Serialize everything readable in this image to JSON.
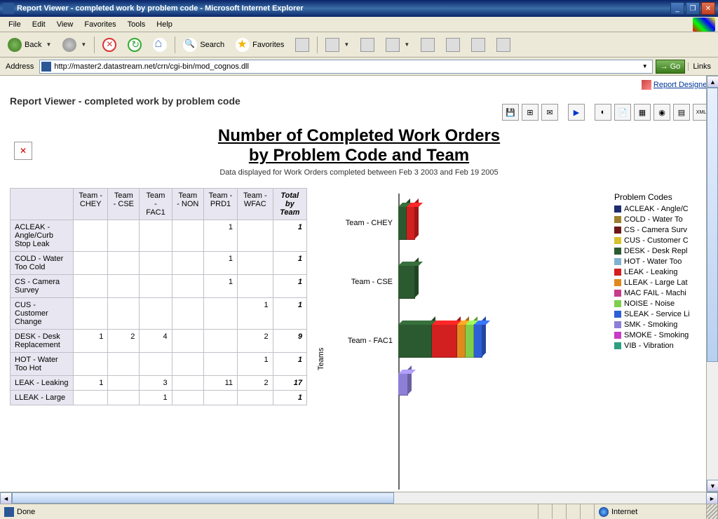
{
  "window": {
    "title": "Report Viewer - completed work by problem code - Microsoft Internet Explorer",
    "min": "_",
    "restore": "❐",
    "close": "✕"
  },
  "menu": {
    "file": "File",
    "edit": "Edit",
    "view": "View",
    "favorites": "Favorites",
    "tools": "Tools",
    "help": "Help"
  },
  "toolbar": {
    "back": "Back",
    "search": "Search",
    "favorites": "Favorites"
  },
  "address": {
    "label": "Address",
    "url": "http://master2.datastream.net/crn/cgi-bin/mod_cognos.dll",
    "go": "Go",
    "links": "Links"
  },
  "content": {
    "designer": "Report Designer",
    "page_title": "Report Viewer - completed work by problem code",
    "chart_title_l1": "Number of Completed Work Orders",
    "chart_title_l2": "by Problem Code and Team",
    "subtitle": "Data displayed for Work Orders completed between Feb 3 2003 and Feb 19 2005",
    "columns": [
      "Team - CHEY",
      "Team - CSE",
      "Team - FAC1",
      "Team - NON",
      "Team - PRD1",
      "Team - WFAC"
    ],
    "total_col": "Total by Team",
    "rows": [
      {
        "label": "ACLEAK - Angle/Curb Stop Leak",
        "cells": [
          "",
          "",
          "",
          "",
          "1",
          ""
        ],
        "total": "1"
      },
      {
        "label": "COLD - Water Too Cold",
        "cells": [
          "",
          "",
          "",
          "",
          "1",
          ""
        ],
        "total": "1"
      },
      {
        "label": "CS - Camera Survey",
        "cells": [
          "",
          "",
          "",
          "",
          "1",
          ""
        ],
        "total": "1"
      },
      {
        "label": "CUS - Customer Change",
        "cells": [
          "",
          "",
          "",
          "",
          "",
          "1"
        ],
        "total": "1"
      },
      {
        "label": "DESK - Desk Replacement",
        "cells": [
          "1",
          "2",
          "4",
          "",
          "",
          "2"
        ],
        "total": "9"
      },
      {
        "label": "HOT - Water Too Hot",
        "cells": [
          "",
          "",
          "",
          "",
          "",
          "1"
        ],
        "total": "1"
      },
      {
        "label": "LEAK - Leaking",
        "cells": [
          "1",
          "",
          "3",
          "",
          "11",
          "2"
        ],
        "total": "17"
      },
      {
        "label": "LLEAK - Large",
        "cells": [
          "",
          "",
          "1",
          "",
          "",
          ""
        ],
        "total": "1"
      }
    ],
    "legend_title": "Problem Codes",
    "legend": [
      {
        "c": "c-acleak",
        "t": "ACLEAK - Angle/C"
      },
      {
        "c": "c-cold",
        "t": "COLD - Water To"
      },
      {
        "c": "c-cs",
        "t": "CS - Camera Surv"
      },
      {
        "c": "c-cus",
        "t": "CUS - Customer C"
      },
      {
        "c": "c-desk",
        "t": "DESK - Desk Repl"
      },
      {
        "c": "c-hot",
        "t": "HOT - Water Too"
      },
      {
        "c": "c-leak",
        "t": "LEAK - Leaking"
      },
      {
        "c": "c-lleak",
        "t": "LLEAK - Large Lat"
      },
      {
        "c": "c-mac",
        "t": "MAC FAIL - Machi"
      },
      {
        "c": "c-noise",
        "t": "NOISE - Noise"
      },
      {
        "c": "c-sleak",
        "t": "SLEAK - Service Li"
      },
      {
        "c": "c-smk",
        "t": "SMK - Smoking"
      },
      {
        "c": "c-smoke",
        "t": "SMOKE - Smoking"
      },
      {
        "c": "c-vib",
        "t": "VIB - Vibration"
      }
    ],
    "axis": "Teams",
    "bar_teams": [
      "Team - CHEY",
      "Team - CSE",
      "Team - FAC1"
    ]
  },
  "status": {
    "done": "Done",
    "zone": "Internet"
  },
  "chart_data": {
    "type": "bar",
    "orientation": "horizontal-stacked",
    "title": "Number of Completed Work Orders by Problem Code and Team",
    "ylabel": "Teams",
    "categories": [
      "Team - CHEY",
      "Team - CSE",
      "Team - FAC1",
      "Team - NON",
      "Team - PRD1",
      "Team - WFAC"
    ],
    "series": [
      {
        "name": "ACLEAK",
        "values": [
          0,
          0,
          0,
          0,
          1,
          0
        ]
      },
      {
        "name": "COLD",
        "values": [
          0,
          0,
          0,
          0,
          1,
          0
        ]
      },
      {
        "name": "CS",
        "values": [
          0,
          0,
          0,
          0,
          1,
          0
        ]
      },
      {
        "name": "CUS",
        "values": [
          0,
          0,
          0,
          0,
          0,
          1
        ]
      },
      {
        "name": "DESK",
        "values": [
          1,
          2,
          4,
          0,
          0,
          2
        ]
      },
      {
        "name": "HOT",
        "values": [
          0,
          0,
          0,
          0,
          0,
          1
        ]
      },
      {
        "name": "LEAK",
        "values": [
          1,
          0,
          3,
          0,
          11,
          2
        ]
      },
      {
        "name": "LLEAK",
        "values": [
          0,
          0,
          1,
          0,
          0,
          0
        ]
      },
      {
        "name": "NOISE",
        "values": [
          0,
          0,
          1,
          0,
          0,
          0
        ]
      },
      {
        "name": "SLEAK",
        "values": [
          0,
          0,
          1,
          0,
          0,
          0
        ]
      }
    ]
  }
}
